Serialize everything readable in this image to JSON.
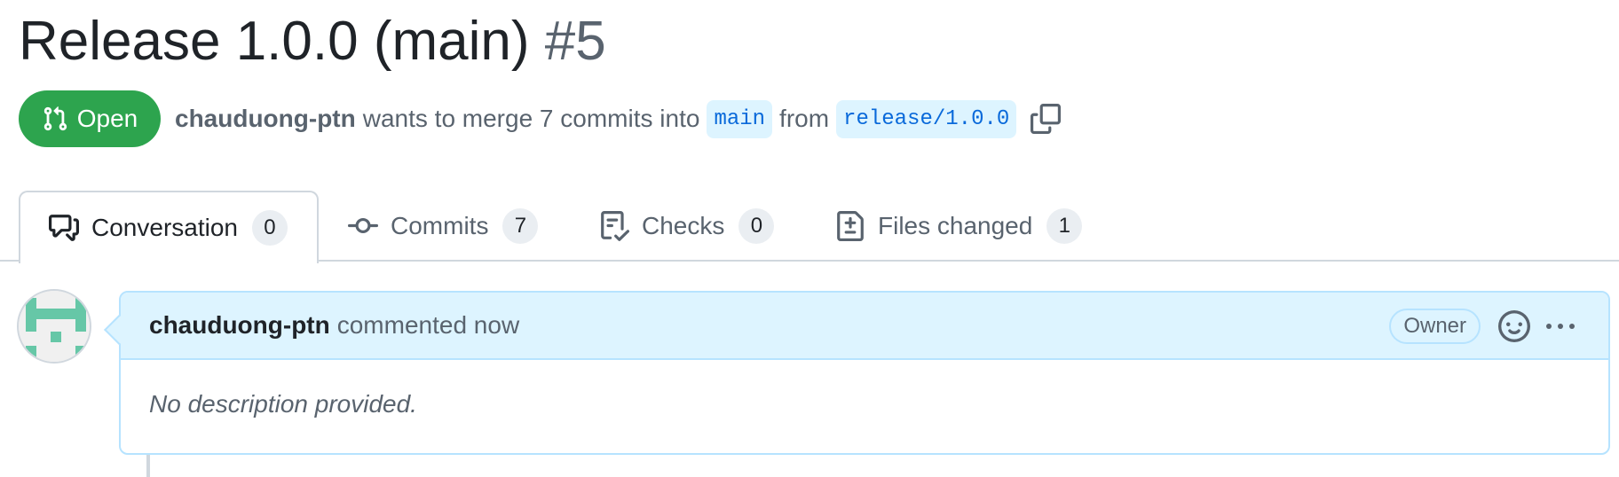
{
  "pr": {
    "title": "Release 1.0.0 (main)",
    "number": "#5",
    "state_label": "Open",
    "author": "chauduong-ptn",
    "merge_text": "wants to merge 7 commits into",
    "base_branch": "main",
    "from_text": "from",
    "head_branch": "release/1.0.0"
  },
  "tabs": [
    {
      "label": "Conversation",
      "count": "0",
      "icon": "comment-discussion-icon"
    },
    {
      "label": "Commits",
      "count": "7",
      "icon": "git-commit-icon"
    },
    {
      "label": "Checks",
      "count": "0",
      "icon": "checklist-icon"
    },
    {
      "label": "Files changed",
      "count": "1",
      "icon": "file-diff-icon"
    }
  ],
  "comment": {
    "author": "chauduong-ptn",
    "action": "commented now",
    "role_badge": "Owner",
    "body": "No description provided."
  },
  "colors": {
    "open_green": "#2da44e",
    "branch_blue": "#0969da",
    "header_bg": "#ddf4ff",
    "avatar_green": "#66c7a7"
  }
}
